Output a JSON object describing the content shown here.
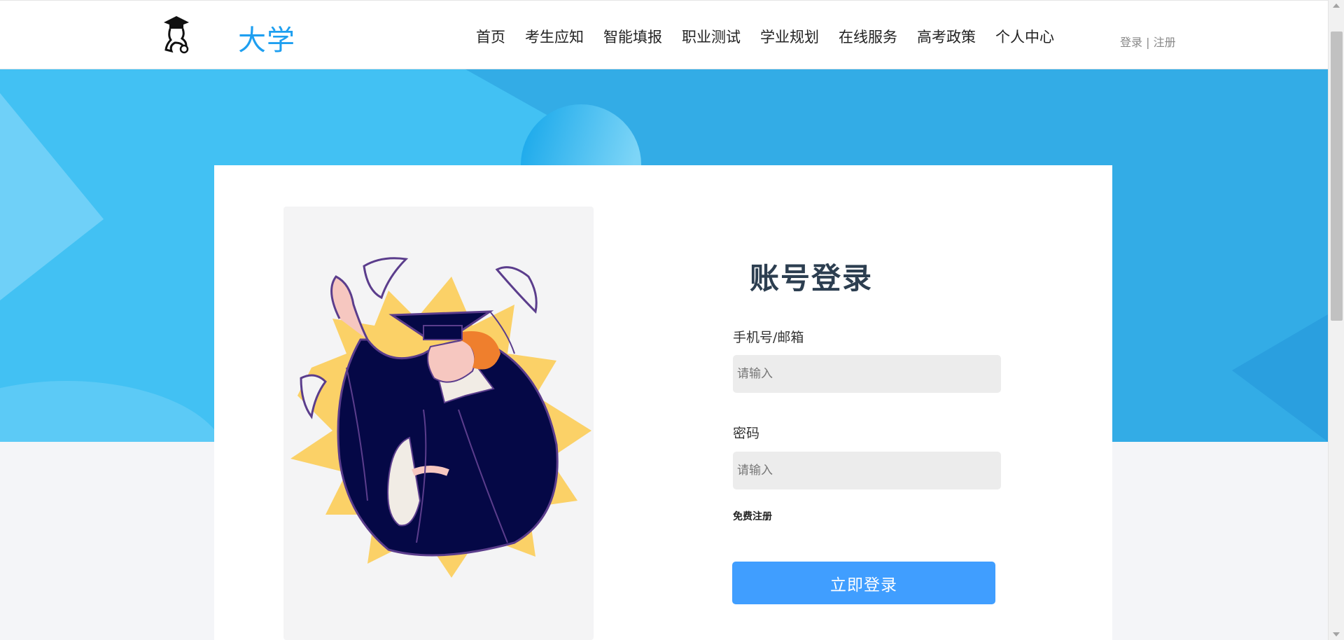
{
  "header": {
    "brand": "大学",
    "nav": [
      "首页",
      "考生应知",
      "智能填报",
      "职业测试",
      "学业规划",
      "在线服务",
      "高考政策",
      "个人中心"
    ],
    "login": "登录",
    "separator": "|",
    "register": "注册"
  },
  "login_form": {
    "title": "账号登录",
    "account_label": "手机号/邮箱",
    "account_placeholder": "请输入",
    "password_label": "密码",
    "password_placeholder": "请输入",
    "register_link": "免费注册",
    "submit_label": "立即登录"
  },
  "colors": {
    "brand": "#1e9ff0",
    "hero": "#33ace6",
    "button": "#409eff",
    "illustration_gown": "#050846",
    "illustration_burst": "#fbd167"
  },
  "icons": [
    "graduate-logo-icon"
  ]
}
